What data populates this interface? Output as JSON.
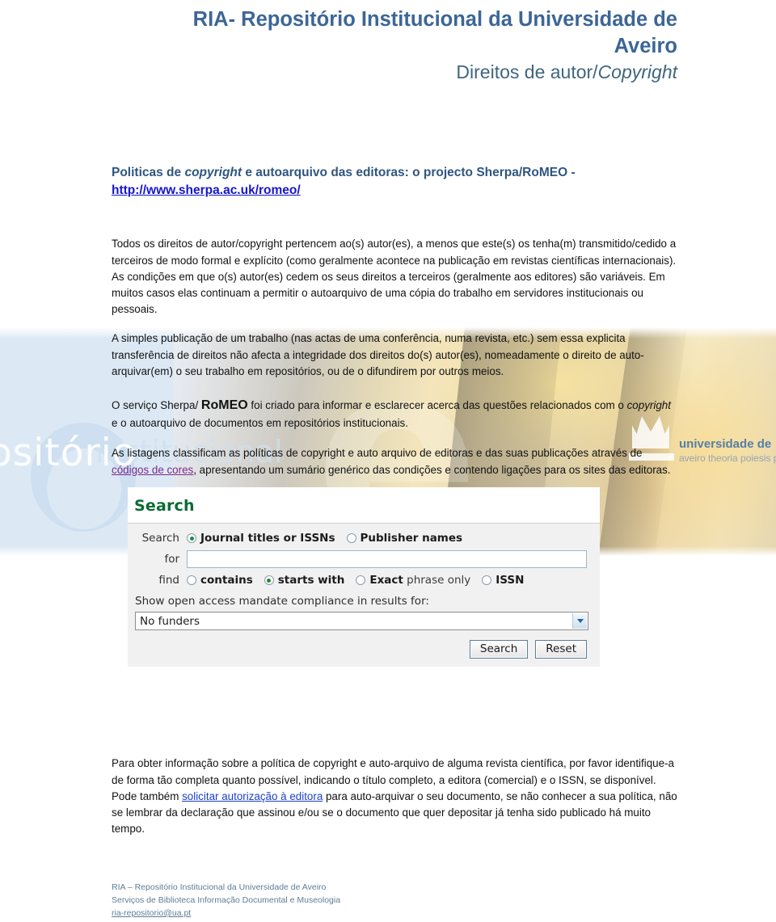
{
  "header": {
    "title": "RIA- Repositório Institucional da Universidade de Aveiro",
    "subtitle_plain": "Direitos de autor/",
    "subtitle_italic": "Copyright"
  },
  "section": {
    "heading_a": "Politicas de ",
    "heading_italic": "copyright",
    "heading_b": " e autoarquivo das editoras: o projecto Sherpa/RoMEO - ",
    "link_text": "http://www.sherpa.ac.uk/romeo/"
  },
  "paragraphs": {
    "p1": "Todos os direitos de autor/copyright pertencem ao(s) autor(es), a menos que este(s) os tenha(m) transmitido/cedido a terceiros de modo formal e explícito (como geralmente acontece na publicação em revistas científicas internacionais). As condições em que o(s) autor(es) cedem os seus direitos a terceiros (geralmente aos editores) são variáveis. Em muitos casos elas continuam a permitir o autoarquivo de uma cópia do trabalho em servidores institucionais ou pessoais.",
    "p2": "A simples publicação de um trabalho (nas actas de uma conferência, numa revista, etc.) sem essa explicita transferência de direitos não afecta a integridade dos direitos do(s) autor(es), nomeadamente o direito de auto-arquivar(em) o seu trabalho em repositórios, ou de o difundirem por outros meios.",
    "p3_a": "O serviço Sherpa/ ",
    "p3_romeo": "RoMEO",
    "p3_b": " foi criado para informar e esclarecer acerca das questões relacionados com o ",
    "p3_italic": "copyright",
    "p3_c": " e o autoarquivo de documentos em repositórios institucionais.",
    "p4_a": "As listagens classificam as políticas de copyright e auto arquivo de editoras e das suas publicações através de ",
    "p4_link": "códigos de cores",
    "p4_b": ", apresentando um sumário genérico das condições e contendo ligações para os sites das editoras.",
    "p5_a": "Para obter informação sobre a política de copyright e auto-arquivo de alguma revista científica, por favor identifique-a de forma tão completa quanto possível, indicando o título completo, a editora (comercial) e o ISSN, se disponível.",
    "p5_b": "Pode também ",
    "p5_link": "solicitar autorização à editora",
    "p5_c": " para auto-arquivar o seu documento, se não conhecer a sua política, não se lembrar da declaração que assinou e/ou se o documento que quer depositar já tenha sido publicado há muito tempo."
  },
  "sherpa": {
    "title": "Search",
    "search_label": "Search",
    "option_journal": "Journal titles or ISSNs",
    "option_publisher": "Publisher names",
    "for_label": "for",
    "for_value": "",
    "find_label": "find",
    "find_contains": "contains",
    "find_starts_with": "starts with",
    "find_exact_bold": "Exact",
    "find_exact_rest": " phrase only",
    "find_issn": "ISSN",
    "mandate_note": "Show open access mandate compliance in results for:",
    "funder_selected": "No funders",
    "search_button": "Search",
    "reset_button": "Reset",
    "title_color": "#0b6b34",
    "selected_radio_color": "#1f8a3b"
  },
  "background": {
    "watermark_word": "ositório",
    "watermark_word2": "institucional",
    "ua_line1": "universidade de",
    "ua_line2": "aveiro theoria poiesis praxis"
  },
  "footer": {
    "line1": "RIA – Repositório Institucional da Universidade de Aveiro",
    "line2": "Serviços de Biblioteca Informação Documental e Museologia",
    "email": "ria-repositorio@ua.pt"
  }
}
